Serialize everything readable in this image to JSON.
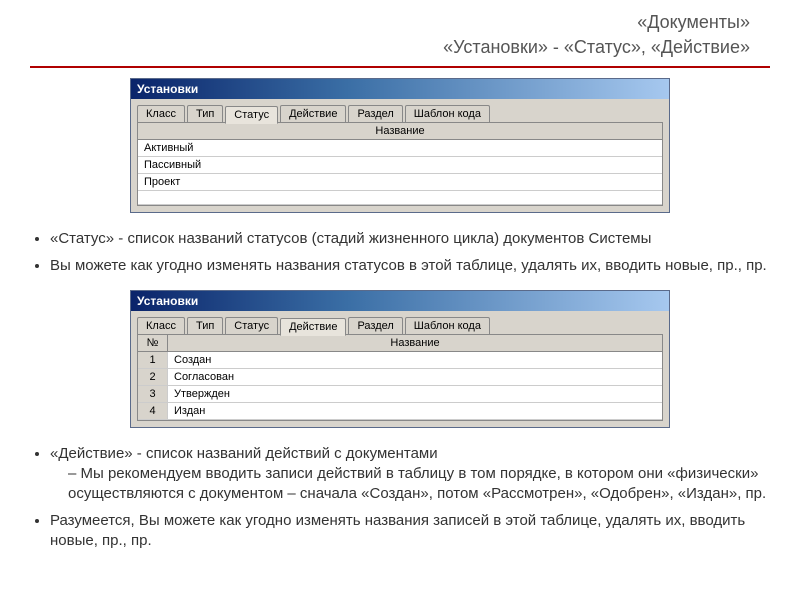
{
  "header": {
    "line1": "«Документы»",
    "line2": "«Установки» - «Статус», «Действие»"
  },
  "win1": {
    "title": "Установки",
    "tabs": [
      "Класс",
      "Тип",
      "Статус",
      "Действие",
      "Раздел",
      "Шаблон кода"
    ],
    "active_tab_index": 2,
    "grid_header": {
      "name": "Название"
    },
    "rows": [
      "Активный",
      "Пассивный",
      "Проект"
    ]
  },
  "text1": {
    "item1_lead": "«Статус»",
    "item1_rest": " - список названий статусов (стадий жизненного цикла) документов Системы",
    "item2": "Вы можете как угодно изменять названия статусов в этой таблице, удалять их, вводить новые, пр., пр."
  },
  "win2": {
    "title": "Установки",
    "tabs": [
      "Класс",
      "Тип",
      "Статус",
      "Действие",
      "Раздел",
      "Шаблон кода"
    ],
    "active_tab_index": 3,
    "grid_header": {
      "num": "№",
      "name": "Название"
    },
    "rows": [
      {
        "num": "1",
        "name": "Создан"
      },
      {
        "num": "2",
        "name": "Согласован"
      },
      {
        "num": "3",
        "name": "Утвержден"
      },
      {
        "num": "4",
        "name": "Издан"
      }
    ]
  },
  "text2": {
    "item1_lead": "«Действие»",
    "item1_rest": " - список названий действий с документами",
    "sub1": "Мы рекомендуем вводить записи действий в таблицу в том порядке, в котором они «физически» осуществляются с документом – сначала «Создан», потом «Рассмотрен», «Одобрен», «Издан», пр.",
    "item2": "Разумеется, Вы можете как угодно изменять названия записей в этой таблице, удалять их, вводить новые, пр., пр."
  }
}
